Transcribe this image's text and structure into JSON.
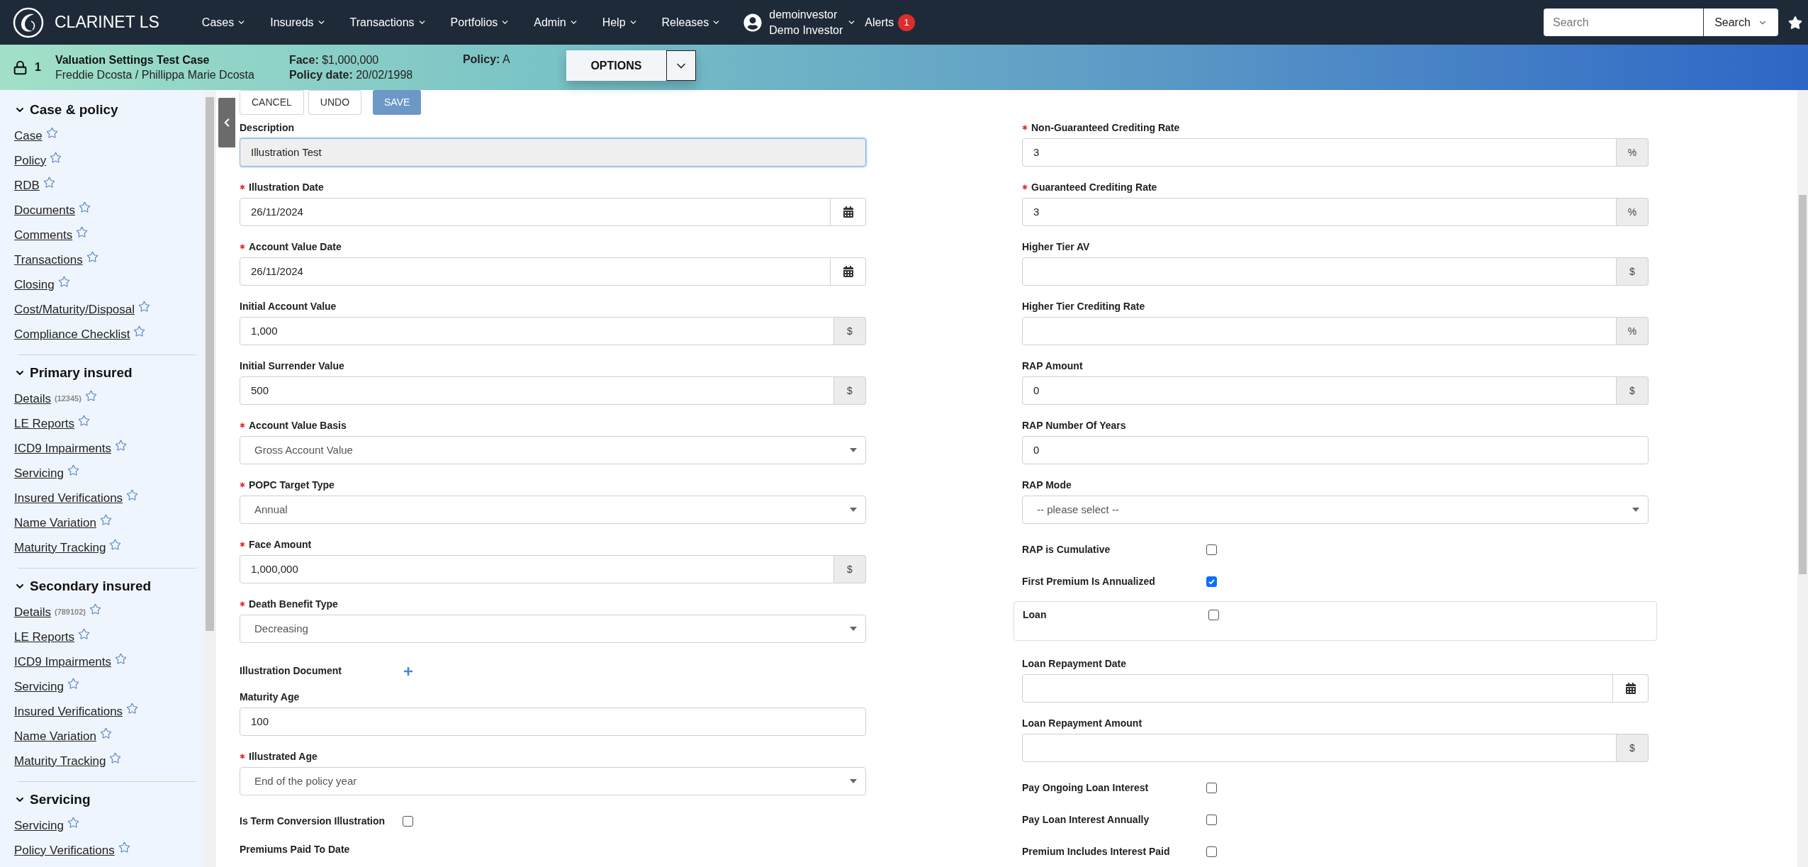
{
  "brand": "CLARINET LS",
  "nav": [
    {
      "label": "Cases"
    },
    {
      "label": "Insureds"
    },
    {
      "label": "Transactions"
    },
    {
      "label": "Portfolios"
    },
    {
      "label": "Admin"
    },
    {
      "label": "Help"
    },
    {
      "label": "Releases"
    }
  ],
  "user": {
    "username": "demoinvestor",
    "name": "Demo Investor"
  },
  "alerts": {
    "label": "Alerts",
    "count": "1"
  },
  "search": {
    "placeholder": "Search",
    "button": "Search"
  },
  "case_header": {
    "lock_number": "1",
    "title": "Valuation Settings Test Case",
    "insureds": "Freddie Dcosta / Phillippa Marie Dcosta",
    "face_label": "Face:",
    "face": "$1,000,000",
    "policy_date_label": "Policy date:",
    "policy_date": "20/02/1998",
    "policy_label": "Policy:",
    "policy": "A",
    "options": "OPTIONS"
  },
  "sidebar": {
    "sections": [
      {
        "title": "Case & policy",
        "expanded": true,
        "items": [
          {
            "label": "Case",
            "favorite": false
          },
          {
            "label": "Policy",
            "favorite": false
          },
          {
            "label": "RDB",
            "favorite": false
          },
          {
            "label": "Documents",
            "favorite": false
          },
          {
            "label": "Comments",
            "favorite": false
          },
          {
            "label": "Transactions",
            "favorite": false
          },
          {
            "label": "Closing",
            "favorite": false
          },
          {
            "label": "Cost/Maturity/Disposal",
            "favorite": false
          },
          {
            "label": "Compliance Checklist",
            "favorite": false
          }
        ]
      },
      {
        "title": "Primary insured",
        "expanded": true,
        "items": [
          {
            "label": "Details",
            "badge": "(12345)",
            "favorite": false
          },
          {
            "label": "LE Reports",
            "favorite": false
          },
          {
            "label": "ICD9 Impairments",
            "favorite": false
          },
          {
            "label": "Servicing",
            "favorite": false
          },
          {
            "label": "Insured Verifications",
            "favorite": false
          },
          {
            "label": "Name Variation",
            "favorite": false
          },
          {
            "label": "Maturity Tracking",
            "favorite": false
          }
        ]
      },
      {
        "title": "Secondary insured",
        "expanded": true,
        "items": [
          {
            "label": "Details",
            "badge": "(789102)",
            "favorite": false
          },
          {
            "label": "LE Reports",
            "favorite": false
          },
          {
            "label": "ICD9 Impairments",
            "favorite": false
          },
          {
            "label": "Servicing",
            "favorite": false
          },
          {
            "label": "Insured Verifications",
            "favorite": false
          },
          {
            "label": "Name Variation",
            "favorite": false
          },
          {
            "label": "Maturity Tracking",
            "favorite": false
          }
        ]
      },
      {
        "title": "Servicing",
        "expanded": true,
        "items": [
          {
            "label": "Servicing",
            "favorite": false
          },
          {
            "label": "Policy Verifications",
            "favorite": false
          }
        ]
      }
    ]
  },
  "toolbar": [
    {
      "label": "CANCEL",
      "kind": "default"
    },
    {
      "label": "UNDO",
      "kind": "default"
    },
    {
      "label": "SAVE",
      "kind": "primary"
    }
  ],
  "form": {
    "left": [
      {
        "kind": "text",
        "label": "Description",
        "required": false,
        "value": "Illustration Test",
        "focused": true
      },
      {
        "kind": "date",
        "label": "Illustration Date",
        "required": true,
        "value": "26/11/2024",
        "focused": false
      },
      {
        "kind": "date",
        "label": "Account Value Date",
        "required": true,
        "value": "26/11/2024",
        "focused": false
      },
      {
        "kind": "text",
        "label": "Initial Account Value",
        "required": false,
        "value": "1,000",
        "addon": "$",
        "focused": false
      },
      {
        "kind": "text",
        "label": "Initial Surrender Value",
        "required": false,
        "value": "500",
        "addon": "$",
        "focused": false
      },
      {
        "kind": "select",
        "label": "Account Value Basis",
        "required": true,
        "value": "Gross Account Value",
        "focused": false
      },
      {
        "kind": "select",
        "label": "POPC Target Type",
        "required": true,
        "value": "Annual",
        "focused": false
      },
      {
        "kind": "text",
        "label": "Face Amount",
        "required": true,
        "value": "1,000,000",
        "addon": "$",
        "focused": false
      },
      {
        "kind": "select",
        "label": "Death Benefit Type",
        "required": true,
        "value": "Decreasing",
        "focused": false
      },
      {
        "kind": "upload",
        "label": "Illustration Document",
        "required": false
      },
      {
        "kind": "text",
        "label": "Maturity Age",
        "required": false,
        "value": "100",
        "focused": false
      },
      {
        "kind": "select",
        "label": "Illustrated Age",
        "required": true,
        "value": "End of the policy year",
        "focused": false
      },
      {
        "kind": "checkbox",
        "label": "Is Term Conversion Illustration",
        "required": false,
        "checked": false
      },
      {
        "kind": "heading",
        "label": "Premiums Paid To Date",
        "required": false
      }
    ],
    "right": [
      {
        "kind": "text",
        "label": "Non-Guaranteed Crediting Rate",
        "required": true,
        "value": "3",
        "addon": "%",
        "focused": false
      },
      {
        "kind": "text",
        "label": "Guaranteed Crediting Rate",
        "required": true,
        "value": "3",
        "addon": "%",
        "focused": false
      },
      {
        "kind": "text",
        "label": "Higher Tier AV",
        "required": false,
        "addon": "$",
        "focused": false
      },
      {
        "kind": "text",
        "label": "Higher Tier Crediting Rate",
        "required": false,
        "addon": "%",
        "focused": false
      },
      {
        "kind": "text",
        "label": "RAP Amount",
        "required": false,
        "value": "0",
        "addon": "$",
        "focused": false
      },
      {
        "kind": "text",
        "label": "RAP Number Of Years",
        "required": false,
        "value": "0",
        "focused": false
      },
      {
        "kind": "select",
        "label": "RAP Mode",
        "required": false,
        "placeholder": "-- please select --",
        "focused": false
      },
      {
        "kind": "checkbox",
        "label": "RAP is Cumulative",
        "required": false,
        "checked": false
      },
      {
        "kind": "checkbox",
        "label": "First Premium Is Annualized",
        "required": false,
        "checked": true
      },
      {
        "kind": "boxed_checkbox",
        "label": "Loan",
        "required": false,
        "checked": false
      },
      {
        "kind": "date",
        "label": "Loan Repayment Date",
        "required": false,
        "focused": false
      },
      {
        "kind": "text",
        "label": "Loan Repayment Amount",
        "required": false,
        "addon": "$",
        "focused": false
      },
      {
        "kind": "checkbox",
        "label": "Pay Ongoing Loan Interest",
        "required": false,
        "checked": false
      },
      {
        "kind": "checkbox",
        "label": "Pay Loan Interest Annually",
        "required": false,
        "checked": false
      },
      {
        "kind": "checkbox",
        "label": "Premium Includes Interest Paid",
        "required": false,
        "checked": false
      }
    ]
  }
}
